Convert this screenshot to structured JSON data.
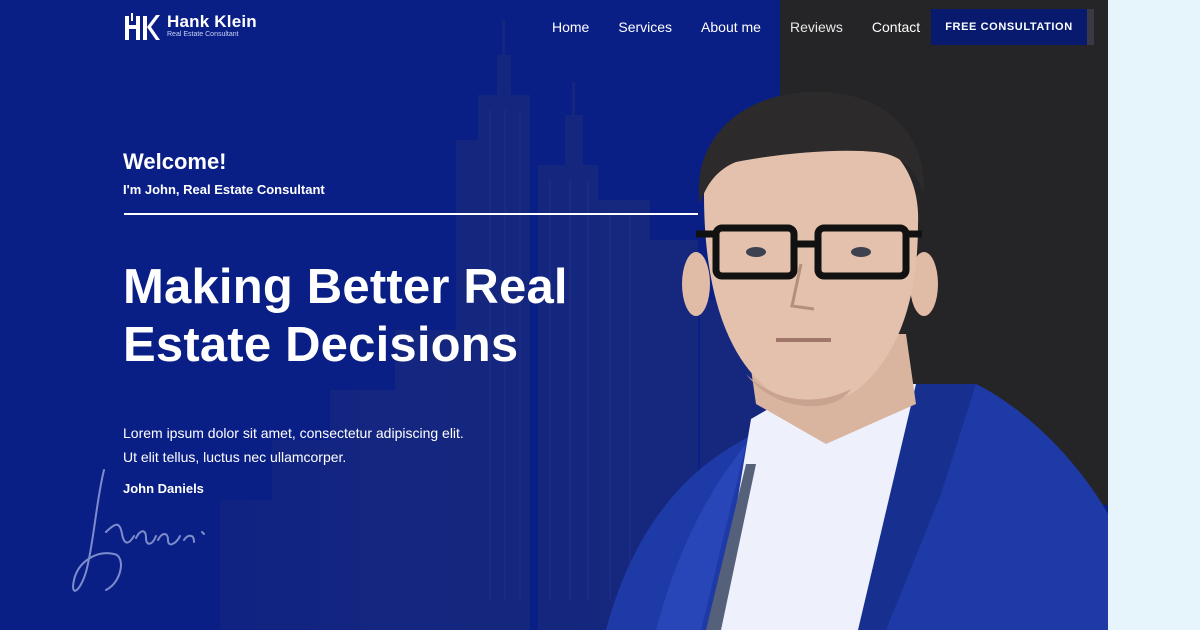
{
  "brand": {
    "name": "Hank Klein",
    "tagline": "Real Estate Consultant"
  },
  "nav": {
    "items": [
      "Home",
      "Services",
      "About me",
      "Reviews",
      "Contact"
    ],
    "cta_label": "FREE CONSULTATION"
  },
  "hero": {
    "welcome": "Welcome!",
    "subtitle": "I'm John, Real Estate Consultant",
    "headline": "Making Better Real Estate Decisions",
    "body_line1": "Lorem ipsum dolor sit amet, consectetur adipiscing elit.",
    "body_line2": "Ut elit tellus, luctus nec ullamcorper.",
    "signer": "John Daniels"
  },
  "colors": {
    "hero_blue": "#0a1f86",
    "cta_navy": "#071a6e",
    "dark_panel": "#252527",
    "page_side": "#e6f4fb",
    "text": "#ffffff"
  },
  "icons": {
    "logo": "hk-monogram-logo",
    "signature": "handwritten-signature"
  }
}
